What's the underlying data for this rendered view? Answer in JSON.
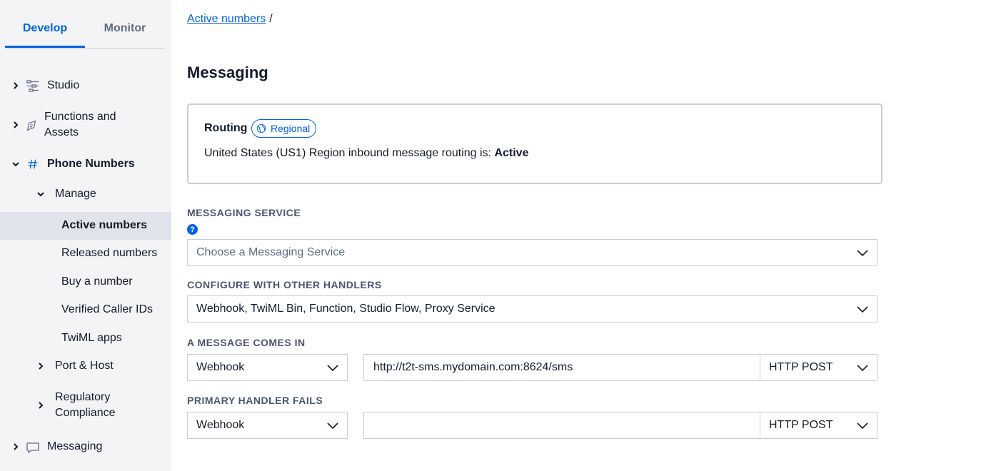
{
  "tabs": {
    "develop": "Develop",
    "monitor": "Monitor"
  },
  "sidebar": {
    "studio": "Studio",
    "functions_line1": "Functions and",
    "functions_line2": "Assets",
    "phone_numbers": "Phone Numbers",
    "manage": "Manage",
    "active_numbers": "Active numbers",
    "released_numbers": "Released numbers",
    "buy_number": "Buy a number",
    "verified_caller_ids": "Verified Caller IDs",
    "twiml_apps": "TwiML apps",
    "port_host": "Port & Host",
    "regulatory_line1": "Regulatory",
    "regulatory_line2": "Compliance",
    "messaging": "Messaging"
  },
  "breadcrumb": {
    "link": "Active numbers",
    "sep": "/"
  },
  "page_title": "Messaging",
  "routing": {
    "title": "Routing",
    "badge": "Regional",
    "text_prefix": "United States (US1) Region inbound message routing is: ",
    "status": "Active"
  },
  "messaging_service": {
    "label": "MESSAGING SERVICE",
    "help": "?",
    "placeholder": "Choose a Messaging Service"
  },
  "other_handlers": {
    "label": "CONFIGURE WITH OTHER HANDLERS",
    "value": "Webhook, TwiML Bin, Function, Studio Flow, Proxy Service"
  },
  "message_comes_in": {
    "label": "A MESSAGE COMES IN",
    "type": "Webhook",
    "url": "http://t2t-sms.mydomain.com:8624/sms",
    "method": "HTTP POST"
  },
  "primary_handler_fails": {
    "label": "PRIMARY HANDLER FAILS",
    "type": "Webhook",
    "url": "",
    "method": "HTTP POST"
  },
  "colors": {
    "accent": "#0263e0",
    "sidebar_bg": "#f4f4f6",
    "active_bg": "#e1e3ea"
  }
}
